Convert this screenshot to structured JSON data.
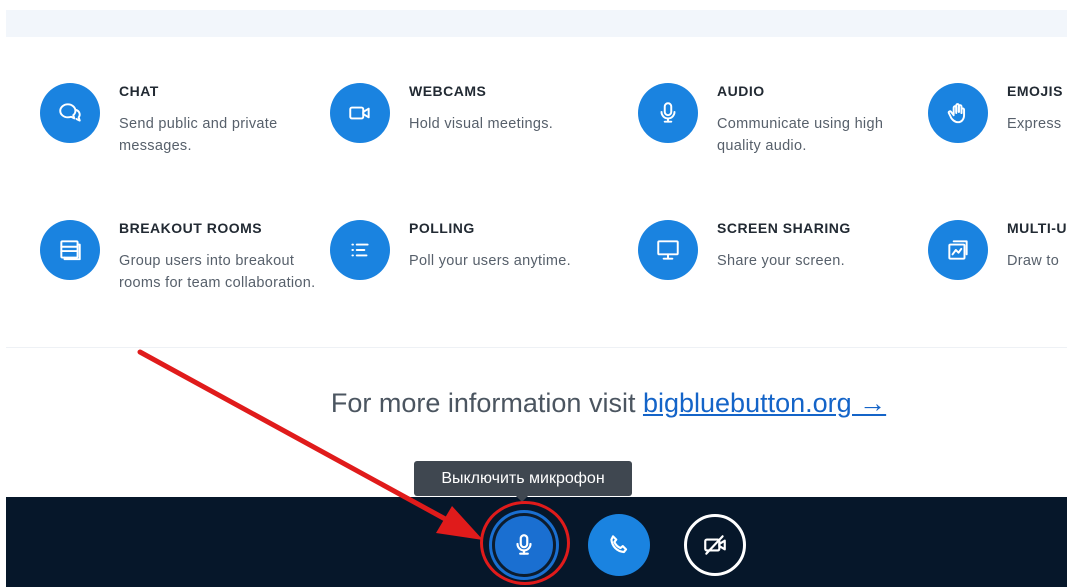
{
  "features": [
    {
      "title": "CHAT",
      "desc": "Send public and private messages.",
      "icon": "chat-bubbles-icon"
    },
    {
      "title": "WEBCAMS",
      "desc": "Hold visual meetings.",
      "icon": "webcam-icon"
    },
    {
      "title": "AUDIO",
      "desc": "Communicate using high quality audio.",
      "icon": "microphone-icon"
    },
    {
      "title": "EMOJIS",
      "desc": "Express",
      "icon": "raised-hand-icon"
    },
    {
      "title": "BREAKOUT ROOMS",
      "desc": "Group users into breakout rooms for team collaboration.",
      "icon": "breakout-rooms-icon"
    },
    {
      "title": "POLLING",
      "desc": "Poll your users anytime.",
      "icon": "list-icon"
    },
    {
      "title": "SCREEN SHARING",
      "desc": "Share your screen.",
      "icon": "monitor-icon"
    },
    {
      "title": "MULTI-U",
      "desc": "Draw to",
      "icon": "whiteboard-icon"
    }
  ],
  "more_info": {
    "prefix": "For more information visit",
    "link": "bigbluebutton.org →"
  },
  "tooltip": "Выключить микрофон",
  "colors": {
    "accent": "#1a83e0",
    "action_bar": "#06172a",
    "highlight": "#e01b1b"
  }
}
